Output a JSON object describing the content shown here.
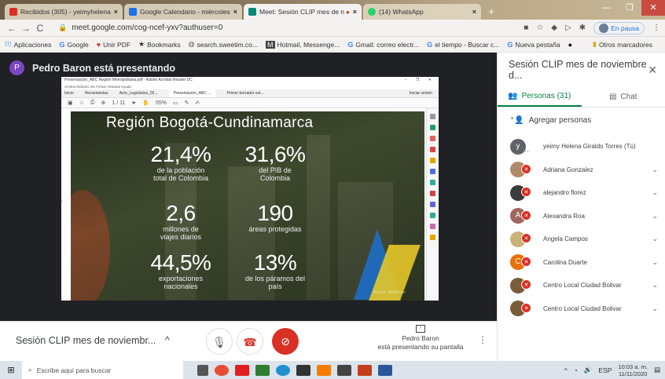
{
  "browser": {
    "tabs": [
      {
        "label": "Recibidos (305) - yeimyhelenag...",
        "color": "#d93025",
        "active": false
      },
      {
        "label": "Google Calendario - miércoles,...",
        "color": "#1a73e8",
        "active": false
      },
      {
        "label": "Meet: Sesión CLIP mes de n...",
        "color": "#00897b",
        "active": true
      },
      {
        "label": "(14) WhatsApp",
        "color": "#25d366",
        "active": false
      }
    ],
    "url": "meet.google.com/cog-ncef-yxv?authuser=0",
    "incognito_label": "En pausa",
    "bookmarks": [
      {
        "label": "Aplicaciones",
        "icon": "apps-grid-icon"
      },
      {
        "label": "Google",
        "icon": "google-g-icon"
      },
      {
        "label": "Unir PDF",
        "icon": "pdf-icon"
      },
      {
        "label": "Bookmarks",
        "icon": "star-icon"
      },
      {
        "label": "search.sweetim.co...",
        "icon": "globe-icon"
      },
      {
        "label": "Hotmail, Messenge...",
        "icon": "msn-icon"
      },
      {
        "label": "Gmail: correo electr...",
        "icon": "google-g-icon"
      },
      {
        "label": "el tiempo - Buscar c...",
        "icon": "google-g-icon"
      },
      {
        "label": "Nueva pestaña",
        "icon": "google-g-icon"
      }
    ],
    "other_bookmarks": "Otros marcadores"
  },
  "meet": {
    "presenter_initial": "P",
    "presenter_title": "Pedro Baron está presentando",
    "meeting_name": "Sesión CLIP mes de noviembr...",
    "presenting_name": "Pedro Baron",
    "presenting_sub": "está presentando su pantalla"
  },
  "presented": {
    "window_title": "Presentación_ABC Región Metropolitana.pdf - Adobe Acrobat Reader DC",
    "menu": "Archivo  Edición  Ver  Firmar  Ventana  Ayuda",
    "tabs": [
      "Inicio",
      "Herramientas",
      "Acto_Legislativo_02...",
      "Presentación_ABC ...",
      "Primer borrador est..."
    ],
    "signin": "Iniciar sesión",
    "toolbar_page": "1 / 11",
    "toolbar_zoom": "55%",
    "slide_title": "Región Bogotá-Cundinamarca",
    "stats": [
      {
        "num": "21,4%",
        "label": "de la población total de Colombia"
      },
      {
        "num": "31,6%",
        "label": "del PIB de Colombia"
      },
      {
        "num": "2,6",
        "label": "millones de viajes diarios"
      },
      {
        "num": "190",
        "label": "áreas protegidas"
      },
      {
        "num": "44,5%",
        "label": "exportaciones nacionales"
      },
      {
        "num": "13%",
        "label": "de los páramos del país"
      }
    ],
    "watermark": "Activar Windows"
  },
  "panel": {
    "title": "Sesión CLIP mes de noviembre d...",
    "people_tab": "Personas (31)",
    "chat_tab": "Chat",
    "add_people": "Agregar personas",
    "participants": [
      {
        "name": "yeimy Helena Giraldo Torres (Tú)",
        "initial": "y",
        "color": "#5f6368",
        "muted": false,
        "self": true
      },
      {
        "name": "Adriana Gonzalez",
        "initial": "",
        "color": "#b08968",
        "muted": true
      },
      {
        "name": "alejandro florez",
        "initial": "",
        "color": "#3c3c3c",
        "muted": true
      },
      {
        "name": "Alexandra Roa",
        "initial": "A",
        "color": "#a1665e",
        "muted": true
      },
      {
        "name": "Angela Campos",
        "initial": "",
        "color": "#c9b27a",
        "muted": true
      },
      {
        "name": "Carolina Duarte",
        "initial": "C",
        "color": "#e8710a",
        "muted": true
      },
      {
        "name": "Centro Local Ciudad Bolivar",
        "initial": "",
        "color": "#7a5c3a",
        "muted": true
      },
      {
        "name": "Centro Local Ciudad Bolivar",
        "initial": "",
        "color": "#7a5c3a",
        "muted": true
      }
    ]
  },
  "taskbar": {
    "search_placeholder": "Escribe aquí para buscar",
    "lang": "ESP",
    "time": "10:03 a. m.",
    "date": "11/11/2020"
  }
}
